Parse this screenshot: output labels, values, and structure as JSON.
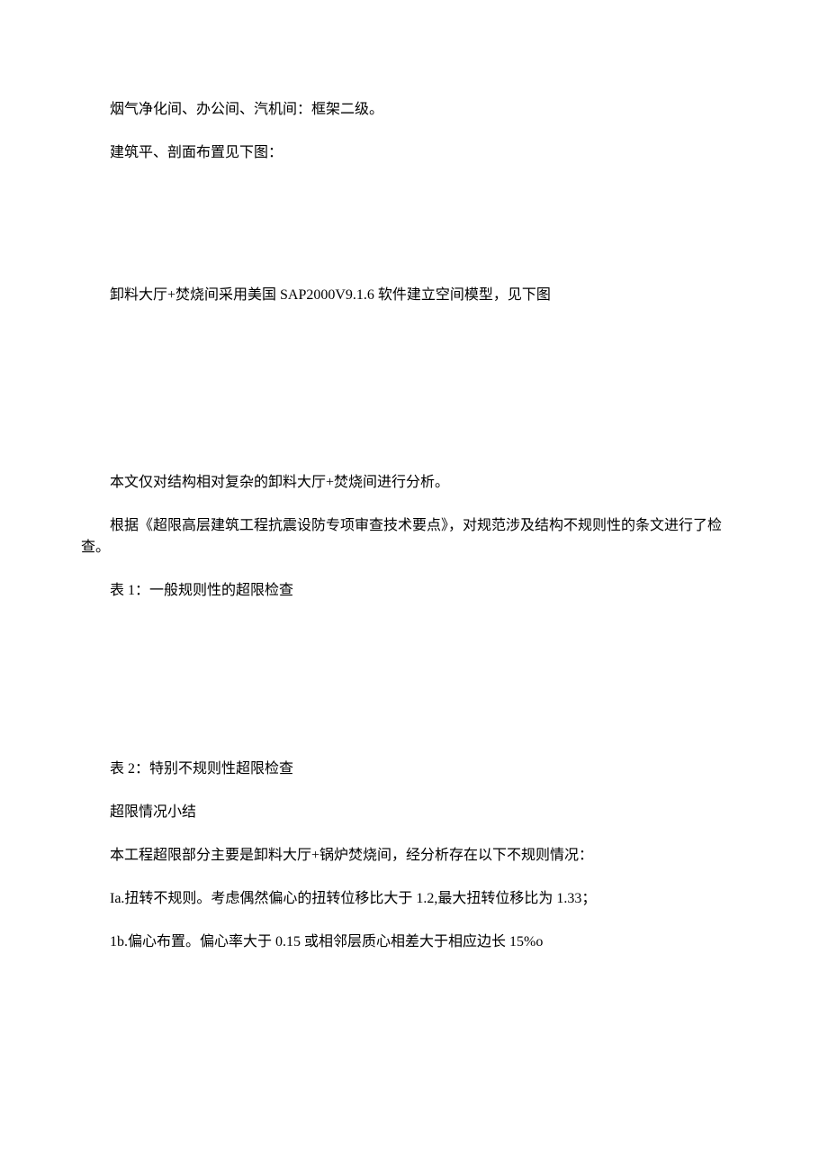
{
  "paragraphs": {
    "p1": "烟气净化间、办公间、汽机间：框架二级。",
    "p2": "建筑平、剖面布置见下图：",
    "p3": "卸料大厅+焚烧间采用美国 SAP2000V9.1.6 软件建立空间模型，见下图",
    "p4": "本文仅对结构相对复杂的卸料大厅+焚烧间进行分析。",
    "p5": "根据《超限高层建筑工程抗震设防专项审查技术要点》，对规范涉及结构不规则性的条文进行了检查。",
    "p6": "表 1：一般规则性的超限检查",
    "p7": "表 2：特别不规则性超限检查",
    "p8": "超限情况小结",
    "p9": "本工程超限部分主要是卸料大厅+锅炉焚烧间，经分析存在以下不规则情况：",
    "p10": "Ia.扭转不规则。考虑偶然偏心的扭转位移比大于 1.2,最大扭转位移比为 1.33；",
    "p11": "1b.偏心布置。偏心率大于 0.15 或相邻层质心相差大于相应边长 15%o"
  }
}
